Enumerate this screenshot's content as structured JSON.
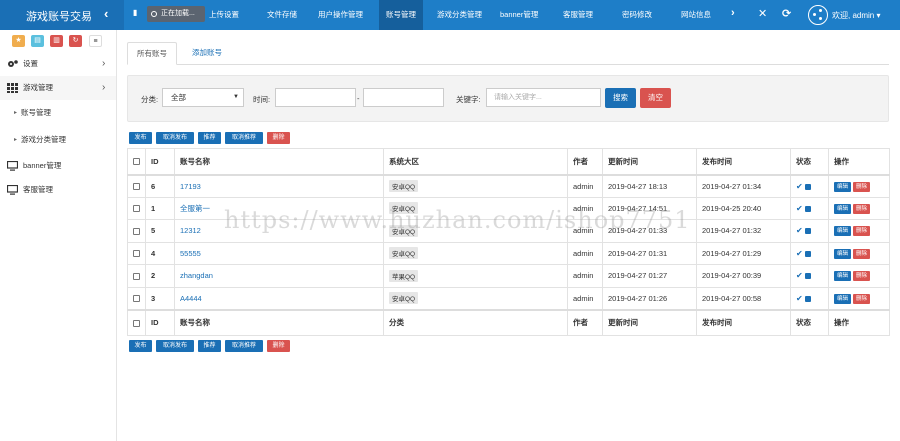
{
  "brand": {
    "title": "游戏账号交易",
    "collapse_icon": "chevron-left-icon"
  },
  "loading": {
    "label": "正在加载..."
  },
  "nav": [
    {
      "label": "上传设置"
    },
    {
      "label": "文件存储"
    },
    {
      "label": "用户操作管理"
    },
    {
      "label": "账号管理"
    },
    {
      "label": "游戏分类管理"
    },
    {
      "label": "banner管理"
    },
    {
      "label": "客服管理"
    },
    {
      "label": "密码修改"
    },
    {
      "label": "网站信息"
    }
  ],
  "user": {
    "welcome": "欢迎, admin ▾"
  },
  "sidebar": {
    "quick_buttons": [
      {
        "icon": "star-icon",
        "color": "#f0ad4e"
      },
      {
        "icon": "file-icon",
        "color": "#5bc0de"
      },
      {
        "icon": "trash-icon",
        "color": "#d9534f"
      },
      {
        "icon": "refresh-icon",
        "color": "#d9534f"
      },
      {
        "icon": "list-icon",
        "color": "#ffffff"
      }
    ],
    "items": [
      {
        "label": "设置",
        "icon": "gears-icon"
      },
      {
        "label": "游戏管理",
        "icon": "grid-icon"
      },
      {
        "label": "账号管理"
      },
      {
        "label": "游戏分类管理"
      },
      {
        "label": "banner管理",
        "icon": "monitor-icon"
      },
      {
        "label": "客服管理",
        "icon": "monitor-icon"
      }
    ]
  },
  "tabs": [
    {
      "label": "所有账号"
    },
    {
      "label": "添加账号"
    }
  ],
  "filter": {
    "category_label": "分类:",
    "category_value": "全部",
    "time_label": "时间:",
    "time_sep": "-",
    "keyword_label": "关键字:",
    "keyword_placeholder": "请输入关键字...",
    "search_label": "搜索",
    "clear_label": "清空"
  },
  "toolbar": {
    "publish": "发布",
    "unpublish": "取消发布",
    "recommend": "推荐",
    "unrecommend": "取消推荐",
    "delete": "删除"
  },
  "table": {
    "headers": {
      "id": "ID",
      "name": "账号名称",
      "region": "系统大区",
      "author": "作者",
      "updated": "更新时间",
      "published": "发布时间",
      "status": "状态",
      "actions": "操作"
    },
    "footer": {
      "id": "ID",
      "name": "账号名称",
      "region": "分类",
      "author": "作者",
      "updated": "更新时间",
      "published": "发布时间",
      "status": "状态",
      "actions": "操作"
    },
    "rows": [
      {
        "id": "6",
        "name": "17193",
        "region": "安卓QQ",
        "author": "admin",
        "updated": "2019-04-27 18:13",
        "published": "2019-04-27 01:34"
      },
      {
        "id": "1",
        "name": "全服第一",
        "region": "安卓QQ",
        "author": "admin",
        "updated": "2019-04-27 14:51",
        "published": "2019-04-25 20:40"
      },
      {
        "id": "5",
        "name": "12312",
        "region": "安卓QQ",
        "author": "admin",
        "updated": "2019-04-27 01:33",
        "published": "2019-04-27 01:32"
      },
      {
        "id": "4",
        "name": "55555",
        "region": "安卓QQ",
        "author": "admin",
        "updated": "2019-04-27 01:31",
        "published": "2019-04-27 01:29"
      },
      {
        "id": "2",
        "name": "zhangdan",
        "region": "苹果QQ",
        "author": "admin",
        "updated": "2019-04-27 01:27",
        "published": "2019-04-27 00:39"
      },
      {
        "id": "3",
        "name": "A4444",
        "region": "安卓QQ",
        "author": "admin",
        "updated": "2019-04-27 01:26",
        "published": "2019-04-27 00:58"
      }
    ],
    "edit_label": "编辑",
    "delete_label": "删除"
  },
  "watermark": "https://www.huzhan.com/ishop7751"
}
